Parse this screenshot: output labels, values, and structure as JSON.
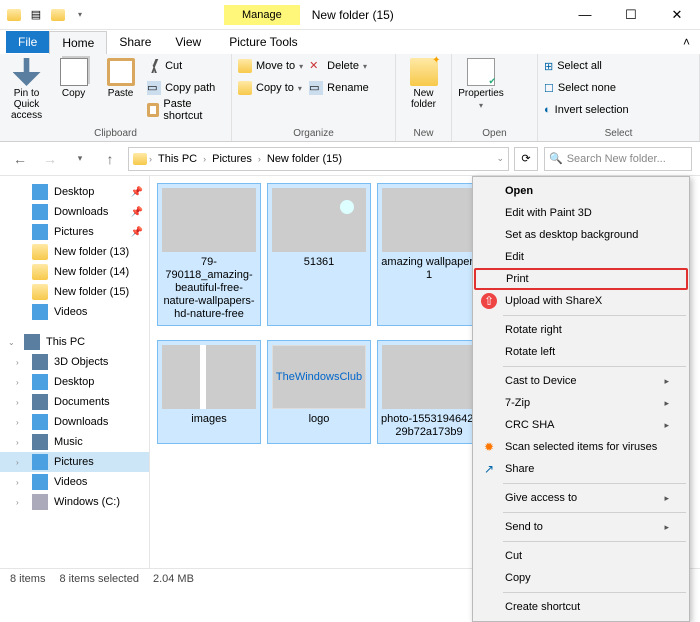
{
  "titlebar": {
    "manage": "Manage",
    "title": "New folder (15)"
  },
  "tabs": {
    "file": "File",
    "home": "Home",
    "share": "Share",
    "view": "View",
    "picture_tools": "Picture Tools"
  },
  "ribbon": {
    "pin": "Pin to Quick access",
    "copy": "Copy",
    "paste": "Paste",
    "cut": "Cut",
    "copy_path": "Copy path",
    "paste_shortcut": "Paste shortcut",
    "clipboard": "Clipboard",
    "move_to": "Move to",
    "copy_to": "Copy to",
    "delete": "Delete",
    "rename": "Rename",
    "organize": "Organize",
    "new_folder": "New folder",
    "new": "New",
    "properties": "Properties",
    "open": "Open",
    "select_all": "Select all",
    "select_none": "Select none",
    "invert": "Invert selection",
    "select": "Select"
  },
  "breadcrumb": {
    "this_pc": "This PC",
    "pictures": "Pictures",
    "folder": "New folder (15)"
  },
  "search": {
    "placeholder": "Search New folder..."
  },
  "nav": {
    "desktop": "Desktop",
    "downloads": "Downloads",
    "pictures": "Pictures",
    "nf13": "New folder (13)",
    "nf14": "New folder (14)",
    "nf15": "New folder (15)",
    "videos": "Videos",
    "this_pc": "This PC",
    "objects3d": "3D Objects",
    "documents": "Documents",
    "music": "Music",
    "windows_c": "Windows (C:)"
  },
  "files": {
    "f1": "79-790118_amazing-beautiful-free-nature-wallpapers-hd-nature-free",
    "f2": "51361",
    "f3": "amazing wallpaper-1",
    "f4": "images",
    "f5": "logo",
    "f5_inner": "TheWindowsClub",
    "f6": "photo-1553194642-29b72a173b9"
  },
  "ctx": {
    "open": "Open",
    "edit_paint3d": "Edit with Paint 3D",
    "set_bg": "Set as desktop background",
    "edit": "Edit",
    "print": "Print",
    "sharex": "Upload with ShareX",
    "rotate_right": "Rotate right",
    "rotate_left": "Rotate left",
    "cast": "Cast to Device",
    "sevenzip": "7-Zip",
    "crcsha": "CRC SHA",
    "scan": "Scan selected items for viruses",
    "share": "Share",
    "give_access": "Give access to",
    "send_to": "Send to",
    "cut": "Cut",
    "copy": "Copy",
    "create_shortcut": "Create shortcut"
  },
  "status": {
    "items": "8 items",
    "selected": "8 items selected",
    "size": "2.04 MB"
  }
}
